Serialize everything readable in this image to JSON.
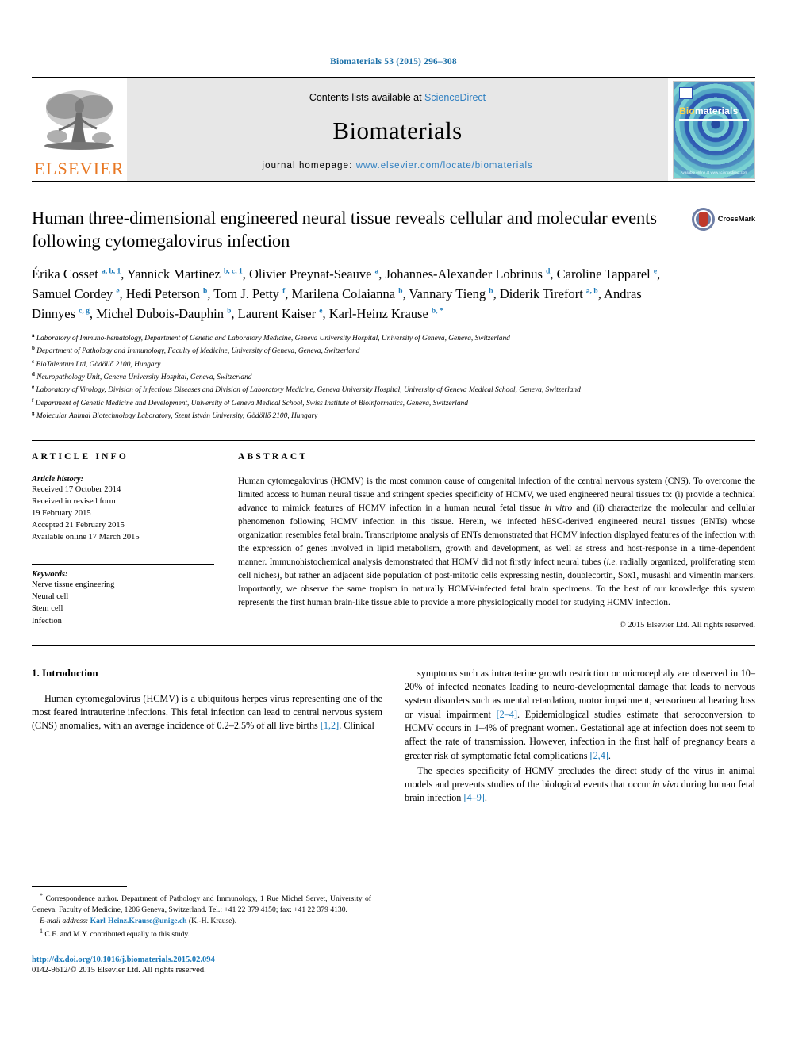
{
  "running_head": "Biomaterials 53 (2015) 296–308",
  "masthead": {
    "contents_prefix": "Contents lists available at ",
    "sciencedirect": "ScienceDirect",
    "journal_name": "Biomaterials",
    "homepage_prefix": "journal homepage: ",
    "homepage_url": "www.elsevier.com/locate/biomaterials",
    "publisher_wordmark": "ELSEVIER",
    "cover_title_bold": "Bio",
    "cover_title_rest": "materials",
    "cover_footer": "Available online at www.sciencedirect.com"
  },
  "article": {
    "title": "Human three-dimensional engineered neural tissue reveals cellular and molecular events following cytomegalovirus infection",
    "crossmark_label": "CrossMark",
    "authors_html": "Érika Cosset <sup>a, b, 1</sup>, Yannick Martinez <sup>b, c, 1</sup>, Olivier Preynat-Seauve <sup>a</sup>, Johannes-Alexander Lobrinus <sup>d</sup>, Caroline Tapparel <sup>e</sup>, Samuel Cordey <sup>e</sup>, Hedi Peterson <sup>b</sup>, Tom J. Petty <sup>f</sup>, Marilena Colaianna <sup>b</sup>, Vannary Tieng <sup>b</sup>, Diderik Tirefort <sup>a, b</sup>, Andras Dinnyes <sup>c, g</sup>, Michel Dubois-Dauphin <sup>b</sup>, Laurent Kaiser <sup>e</sup>, Karl-Heinz Krause <sup>b, *</sup>",
    "affiliations": [
      {
        "marker": "a",
        "text": "Laboratory of Immuno-hematology, Department of Genetic and Laboratory Medicine, Geneva University Hospital, University of Geneva, Geneva, Switzerland"
      },
      {
        "marker": "b",
        "text": "Department of Pathology and Immunology, Faculty of Medicine, University of Geneva, Geneva, Switzerland"
      },
      {
        "marker": "c",
        "text": "BioTalentum Ltd, Gödöllő 2100, Hungary"
      },
      {
        "marker": "d",
        "text": "Neuropathology Unit, Geneva University Hospital, Geneva, Switzerland"
      },
      {
        "marker": "e",
        "text": "Laboratory of Virology, Division of Infectious Diseases and Division of Laboratory Medicine, Geneva University Hospital, University of Geneva Medical School, Geneva, Switzerland"
      },
      {
        "marker": "f",
        "text": "Department of Genetic Medicine and Development, University of Geneva Medical School, Swiss Institute of Bioinformatics, Geneva, Switzerland"
      },
      {
        "marker": "g",
        "text": "Molecular Animal Biotechnology Laboratory, Szent István University, Gödöllő 2100, Hungary"
      }
    ]
  },
  "article_info": {
    "heading": "ARTICLE INFO",
    "history_label": "Article history:",
    "history_lines": [
      "Received 17 October 2014",
      "Received in revised form",
      "19 February 2015",
      "Accepted 21 February 2015",
      "Available online 17 March 2015"
    ],
    "keywords_label": "Keywords:",
    "keywords": [
      "Nerve tissue engineering",
      "Neural cell",
      "Stem cell",
      "Infection"
    ]
  },
  "abstract": {
    "heading": "ABSTRACT",
    "text_html": "Human cytomegalovirus (HCMV) is the most common cause of congenital infection of the central nervous system (CNS). To overcome the limited access to human neural tissue and stringent species specificity of HCMV, we used engineered neural tissues to: (i) provide a technical advance to mimick features of HCMV infection in a human neural fetal tissue <i>in vitro</i> and (ii) characterize the molecular and cellular phenomenon following HCMV infection in this tissue. Herein, we infected hESC-derived engineered neural tissues (ENTs) whose organization resembles fetal brain. Transcriptome analysis of ENTs demonstrated that HCMV infection displayed features of the infection with the expression of genes involved in lipid metabolism, growth and development, as well as stress and host-response in a time-dependent manner. Immunohistochemical analysis demonstrated that HCMV did not firstly infect neural tubes (<i>i.e.</i> radially organized, proliferating stem cell niches), but rather an adjacent side population of post-mitotic cells expressing nestin, doublecortin, Sox1, musashi and vimentin markers. Importantly, we observe the same tropism in naturally HCMV-infected fetal brain specimens. To the best of our knowledge this system represents the first human brain-like tissue able to provide a more physiologically model for studying HCMV infection.",
    "copyright": "© 2015 Elsevier Ltd. All rights reserved."
  },
  "introduction": {
    "heading": "1. Introduction",
    "left_paragraph_html": "Human cytomegalovirus (HCMV) is a ubiquitous herpes virus representing one of the most feared intrauterine infections. This fetal infection can lead to central nervous system (CNS) anomalies, with an average incidence of 0.2–2.5% of all live births <span class=\"ref\">[1,2]</span>. Clinical",
    "right_paragraph_1_html": "symptoms such as intrauterine growth restriction or microcephaly are observed in 10–20% of infected neonates leading to neuro-developmental damage that leads to nervous system disorders such as mental retardation, motor impairment, sensorineural hearing loss or visual impairment <span class=\"ref\">[2–4]</span>. Epidemiological studies estimate that seroconversion to HCMV occurs in 1–4% of pregnant women. Gestational age at infection does not seem to affect the rate of transmission. However, infection in the first half of pregnancy bears a greater risk of symptomatic fetal complications <span class=\"ref\">[2,4]</span>.",
    "right_paragraph_2_html": "The species specificity of HCMV precludes the direct study of the virus in animal models and prevents studies of the biological events that occur <i>in vivo</i> during human fetal brain infection <span class=\"ref\">[4–9]</span>."
  },
  "footnotes": {
    "correspondence_html": "<sup>*</sup> Correspondence author. Department of Pathology and Immunology, 1 Rue Michel Servet, University of Geneva, Faculty of Medicine, 1206 Geneva, Switzerland. Tel.: +41 22 379 4150; fax: +41 22 379 4130.",
    "email_html": "<i>E-mail address:</i> <span class=\"mail\">Karl-Heinz.Krause@unige.ch</span> (K.-H. Krause).",
    "equal_contribution_html": "<sup>1</sup> C.E. and M.Y. contributed equally to this study.",
    "doi": "http://dx.doi.org/10.1016/j.biomaterials.2015.02.094",
    "issn_line": "0142-9612/© 2015 Elsevier Ltd. All rights reserved."
  },
  "colors": {
    "link_blue": "#1a78b8",
    "elsevier_orange": "#E87722",
    "masthead_gray": "#e7e7e7"
  }
}
